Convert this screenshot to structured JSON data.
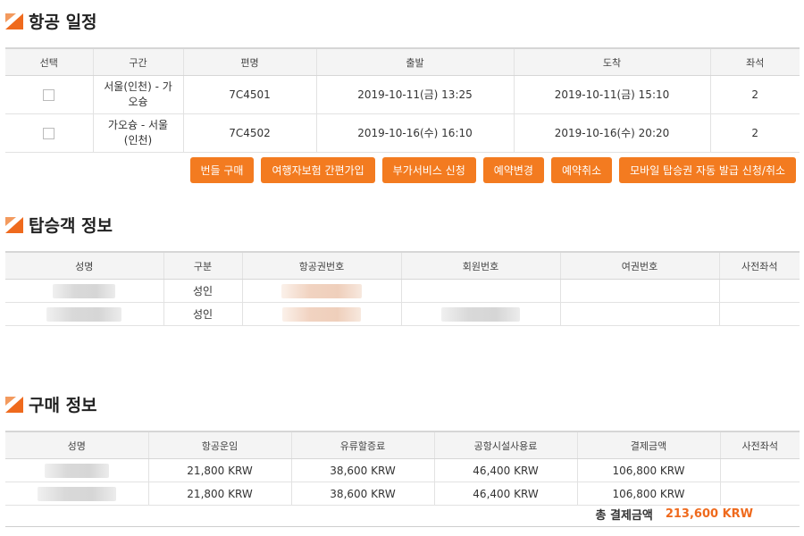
{
  "sections": {
    "flight_title": "항공 일정",
    "passenger_title": "탑승객 정보",
    "purchase_title": "구매 정보"
  },
  "flight_table": {
    "headers": [
      "선택",
      "구간",
      "편명",
      "출발",
      "도착",
      "좌석"
    ],
    "rows": [
      {
        "route": "서울(인천) - 가오슝",
        "flight": "7C4501",
        "depart": "2019-10-11(금) 13:25",
        "arrive": "2019-10-11(금) 15:10",
        "seats": "2"
      },
      {
        "route": "가오슝 - 서울(인천)",
        "flight": "7C4502",
        "depart": "2019-10-16(수) 16:10",
        "arrive": "2019-10-16(수) 20:20",
        "seats": "2"
      }
    ]
  },
  "buttons": [
    "번들 구매",
    "여행자보험 간편가입",
    "부가서비스 신청",
    "예약변경",
    "예약취소",
    "모바일 탑승권 자동 발급 신청/취소"
  ],
  "passenger_table": {
    "headers": [
      "성명",
      "구분",
      "항공권번호",
      "회원번호",
      "여권번호",
      "사전좌석"
    ],
    "rows": [
      {
        "type": "성인"
      },
      {
        "type": "성인"
      }
    ]
  },
  "purchase_table": {
    "headers": [
      "성명",
      "항공운임",
      "유류할증료",
      "공항시설사용료",
      "결제금액",
      "사전좌석"
    ],
    "rows": [
      {
        "fare": "21,800 KRW",
        "fuel": "38,600 KRW",
        "airport": "46,400 KRW",
        "payment": "106,800 KRW"
      },
      {
        "fare": "21,800 KRW",
        "fuel": "38,600 KRW",
        "airport": "46,400 KRW",
        "payment": "106,800 KRW"
      }
    ]
  },
  "total": {
    "label": "총 결제금액",
    "amount": "213,600 KRW"
  },
  "colors": {
    "accent": "#f37b20",
    "total_amount": "#ef6a1d"
  }
}
